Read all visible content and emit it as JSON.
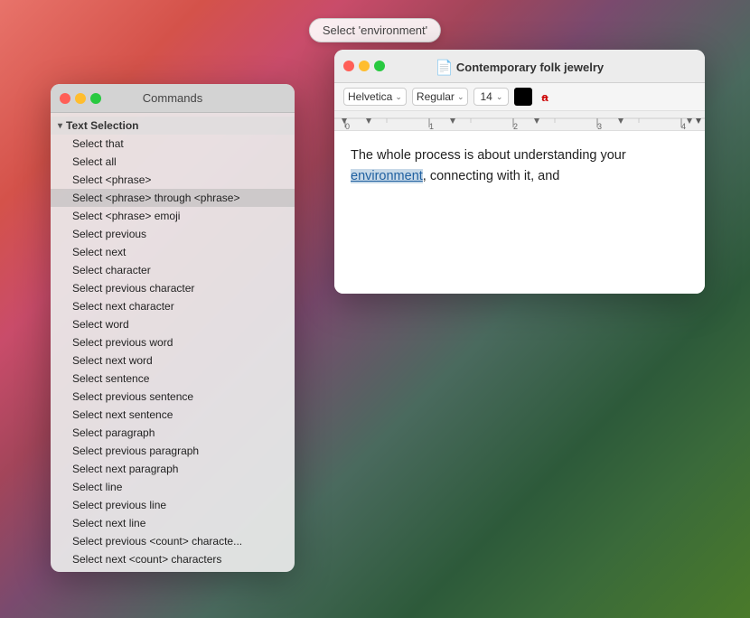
{
  "tooltip": {
    "label": "Select 'environment'"
  },
  "commands_window": {
    "title": "Commands",
    "section": "Text Selection",
    "items": [
      "Select that",
      "Select all",
      "Select <phrase>",
      "Select <phrase> through <phrase>",
      "Select <phrase> emoji",
      "Select previous",
      "Select next",
      "Select character",
      "Select previous character",
      "Select next character",
      "Select word",
      "Select previous word",
      "Select next word",
      "Select sentence",
      "Select previous sentence",
      "Select next sentence",
      "Select paragraph",
      "Select previous paragraph",
      "Select next paragraph",
      "Select line",
      "Select previous line",
      "Select next line",
      "Select previous <count> characte...",
      "Select next <count> characters"
    ],
    "highlighted_index": 3
  },
  "editor_window": {
    "title": "Contemporary folk jewelry",
    "font_family": "Helvetica",
    "font_style": "Regular",
    "font_size": "14",
    "content_before": "The whole process is about understanding your ",
    "content_highlighted": "environment",
    "content_after": ", connecting with it, and"
  },
  "icons": {
    "doc": "📄",
    "chevron_down": "▾",
    "chevron_right": "▸"
  }
}
